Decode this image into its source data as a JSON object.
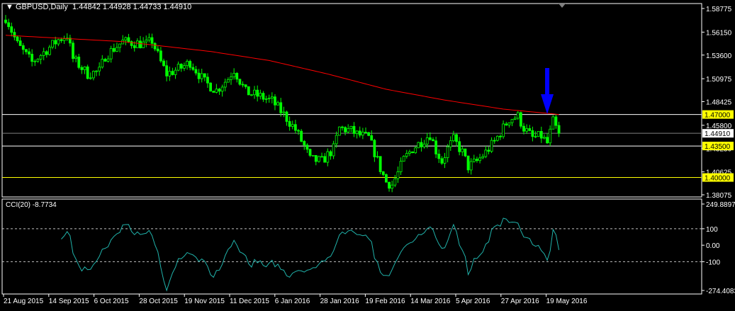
{
  "header": {
    "symbol": "GBPUSD,Daily",
    "ohlc": "1.44842 1.44928 1.44733 1.44910"
  },
  "chart_data": [
    {
      "type": "candlestick",
      "title": "GBPUSD,Daily",
      "ylim": [
        1.38075,
        1.58775
      ],
      "y_ticks": [
        "1.58775",
        "1.56150",
        "1.53600",
        "1.50975",
        "1.48425",
        "1.45800",
        "1.43250",
        "1.40625",
        "1.38075"
      ],
      "x_ticks": [
        "21 Aug 2015",
        "14 Sep 2015",
        "6 Oct 2015",
        "28 Oct 2015",
        "19 Nov 2015",
        "11 Dec 2015",
        "6 Jan 2016",
        "28 Jan 2016",
        "19 Feb 2016",
        "14 Mar 2016",
        "5 Apr 2016",
        "27 Apr 2016",
        "19 May 2016"
      ],
      "bar_count": 190,
      "close_keypoints": [
        [
          0,
          1.578
        ],
        [
          1,
          1.571
        ],
        [
          4,
          1.548
        ],
        [
          9,
          1.528
        ],
        [
          18,
          1.553
        ],
        [
          21,
          1.558
        ],
        [
          23,
          1.532
        ],
        [
          28,
          1.515
        ],
        [
          32,
          1.518
        ],
        [
          34,
          1.535
        ],
        [
          38,
          1.546
        ],
        [
          40,
          1.551
        ],
        [
          48,
          1.548
        ],
        [
          50,
          1.552
        ],
        [
          53,
          1.528
        ],
        [
          55,
          1.515
        ],
        [
          60,
          1.522
        ],
        [
          63,
          1.528
        ],
        [
          68,
          1.506
        ],
        [
          72,
          1.497
        ],
        [
          76,
          1.51
        ],
        [
          78,
          1.52
        ],
        [
          82,
          1.495
        ],
        [
          87,
          1.49
        ],
        [
          91,
          1.485
        ],
        [
          95,
          1.47
        ],
        [
          99,
          1.453
        ],
        [
          102,
          1.435
        ],
        [
          104,
          1.42
        ],
        [
          108,
          1.418
        ],
        [
          112,
          1.432
        ],
        [
          114,
          1.455
        ],
        [
          118,
          1.452
        ],
        [
          120,
          1.448
        ],
        [
          124,
          1.444
        ],
        [
          126,
          1.428
        ],
        [
          128,
          1.41
        ],
        [
          130,
          1.395
        ],
        [
          132,
          1.392
        ],
        [
          134,
          1.405
        ],
        [
          136,
          1.42
        ],
        [
          139,
          1.432
        ],
        [
          142,
          1.44
        ],
        [
          145,
          1.448
        ],
        [
          147,
          1.43
        ],
        [
          149,
          1.418
        ],
        [
          151,
          1.432
        ],
        [
          153,
          1.442
        ],
        [
          156,
          1.428
        ],
        [
          158,
          1.412
        ],
        [
          161,
          1.418
        ],
        [
          164,
          1.428
        ],
        [
          167,
          1.44
        ],
        [
          170,
          1.455
        ],
        [
          172,
          1.465
        ],
        [
          175,
          1.468
        ],
        [
          177,
          1.455
        ],
        [
          180,
          1.444
        ],
        [
          183,
          1.446
        ],
        [
          185,
          1.438
        ],
        [
          187,
          1.462
        ],
        [
          188,
          1.455
        ],
        [
          189,
          1.4491
        ]
      ],
      "ma_keypoints": [
        [
          0,
          1.558
        ],
        [
          40,
          1.551
        ],
        [
          70,
          1.54
        ],
        [
          90,
          1.53
        ],
        [
          110,
          1.515
        ],
        [
          130,
          1.498
        ],
        [
          150,
          1.486
        ],
        [
          170,
          1.476
        ],
        [
          189,
          1.47
        ]
      ],
      "hlines": [
        {
          "value": 1.47,
          "label": "1.47000",
          "color": "#ffffff",
          "tag": "#ffff00"
        },
        {
          "value": 1.4491,
          "label": "1.44910",
          "color": "#808080",
          "tag": "#ffffff"
        },
        {
          "value": 1.435,
          "label": "1.43500",
          "color": "#ffffff",
          "tag": "#ffff00"
        },
        {
          "value": 1.4,
          "label": "1.40000",
          "color": "#ffff00",
          "tag": "#ffff00"
        }
      ],
      "colors": {
        "candle": "#00ff00",
        "ma": "#ff0000",
        "arrow": "#0000ff"
      },
      "annotation": {
        "type": "arrow-down",
        "bar": 185,
        "price": 1.4705
      }
    },
    {
      "type": "line",
      "title": "CCI(20) -8.7734",
      "ylim": [
        -274.4083,
        249.8897
      ],
      "y_ticks": [
        "249.8897",
        "100",
        "0.00",
        "-100",
        "-274.4083"
      ],
      "levels": [
        100,
        -100
      ],
      "color": "#20b2aa"
    }
  ]
}
